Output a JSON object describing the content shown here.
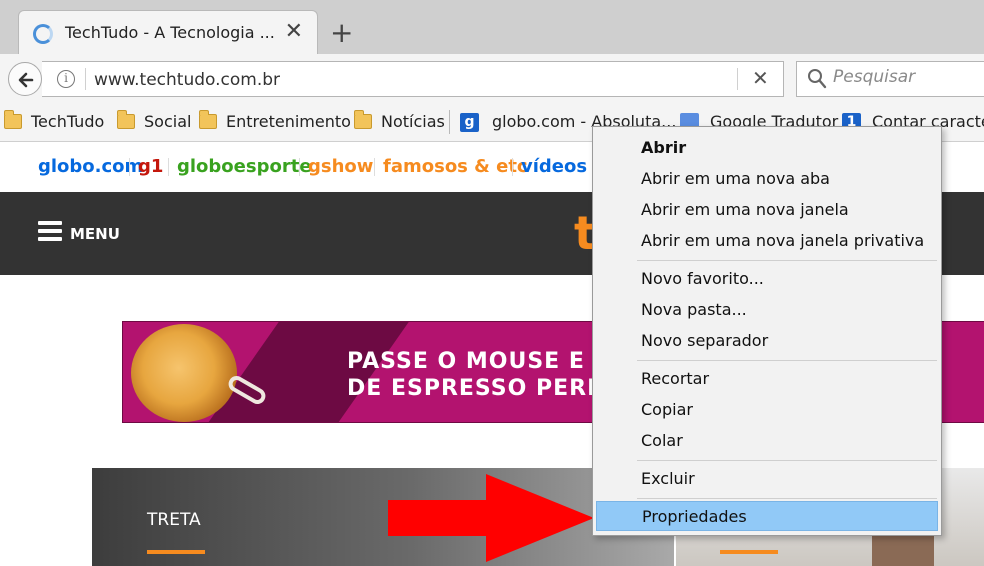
{
  "browser": {
    "tab": {
      "title": "TechTudo - A Tecnologia ..."
    },
    "url": "www.techtudo.com.br",
    "search_placeholder": "Pesquisar",
    "bookmarks": [
      {
        "label": "TechTudo",
        "type": "folder"
      },
      {
        "label": "Social",
        "type": "folder"
      },
      {
        "label": "Entretenimento",
        "type": "folder"
      },
      {
        "label": "Notícias",
        "type": "folder"
      },
      {
        "label": "globo.com - Absoluta...",
        "type": "link",
        "icon": "g-favicon",
        "icon_text": "g",
        "color": "#1a62c8"
      },
      {
        "label": "Google Tradutor",
        "type": "link",
        "icon": "translate-favicon"
      },
      {
        "label": "Contar caracteres",
        "type": "link",
        "icon": "count-favicon",
        "icon_text": "1",
        "color": "#1a62c8"
      }
    ]
  },
  "page": {
    "globo_nav": [
      {
        "label": "globo.com",
        "color": "#0669de"
      },
      {
        "label": "g1",
        "color": "#c4170c"
      },
      {
        "label": "globoesporte",
        "color": "#39a21f"
      },
      {
        "label": "gshow",
        "color": "#f68b1f"
      },
      {
        "label": "famosos & etc",
        "color": "#f68b1f"
      },
      {
        "label": "vídeos",
        "color": "#0669de"
      }
    ],
    "header": {
      "menu_label": "MENU",
      "logo_partial": "t"
    },
    "ad": {
      "line1": "PASSE O MOUSE E DES",
      "line2": "DE ESPRESSO PERFEIT"
    },
    "card": {
      "label": "TRETA"
    }
  },
  "context_menu": {
    "items": [
      {
        "label": "Abrir",
        "bold": true
      },
      {
        "label": "Abrir em uma nova aba"
      },
      {
        "label": "Abrir em uma nova janela"
      },
      {
        "label": "Abrir em uma nova janela privativa"
      },
      {
        "label": "Novo favorito..."
      },
      {
        "label": "Nova pasta..."
      },
      {
        "label": "Novo separador"
      },
      {
        "label": "Recortar"
      },
      {
        "label": "Copiar"
      },
      {
        "label": "Colar"
      },
      {
        "label": "Excluir"
      },
      {
        "label": "Propriedades",
        "highlighted": true
      }
    ]
  },
  "colors": {
    "accent_orange": "#f68b1f",
    "highlight_blue": "#91c9f7",
    "arrow_red": "#ff0000",
    "ad_magenta": "#b3136f"
  }
}
